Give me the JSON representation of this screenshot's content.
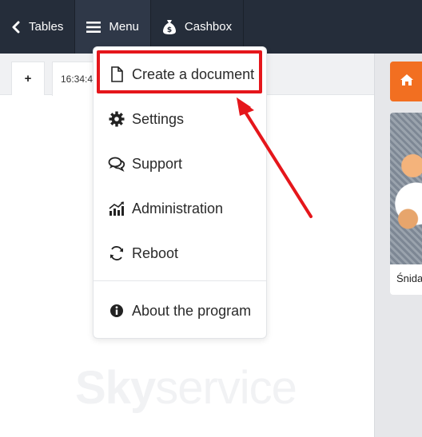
{
  "topbar": {
    "tables_label": "Tables",
    "menu_label": "Menu",
    "cashbox_label": "Cashbox"
  },
  "tabs": {
    "add_label": "+",
    "open_tab_time": "16:34:4"
  },
  "menu": {
    "items": [
      {
        "label": "Create a document",
        "icon": "document-icon"
      },
      {
        "label": "Settings",
        "icon": "gear-icon"
      },
      {
        "label": "Support",
        "icon": "chat-icon"
      },
      {
        "label": "Administration",
        "icon": "chart-icon"
      },
      {
        "label": "Reboot",
        "icon": "reboot-icon"
      },
      {
        "label": "About the program",
        "icon": "info-icon"
      }
    ]
  },
  "products": [
    {
      "name": "Śnida"
    }
  ],
  "watermark": {
    "bold": "Sky",
    "light": "service"
  },
  "colors": {
    "topbar": "#252d3a",
    "accent": "#f26f21",
    "highlight": "#e5161b"
  }
}
